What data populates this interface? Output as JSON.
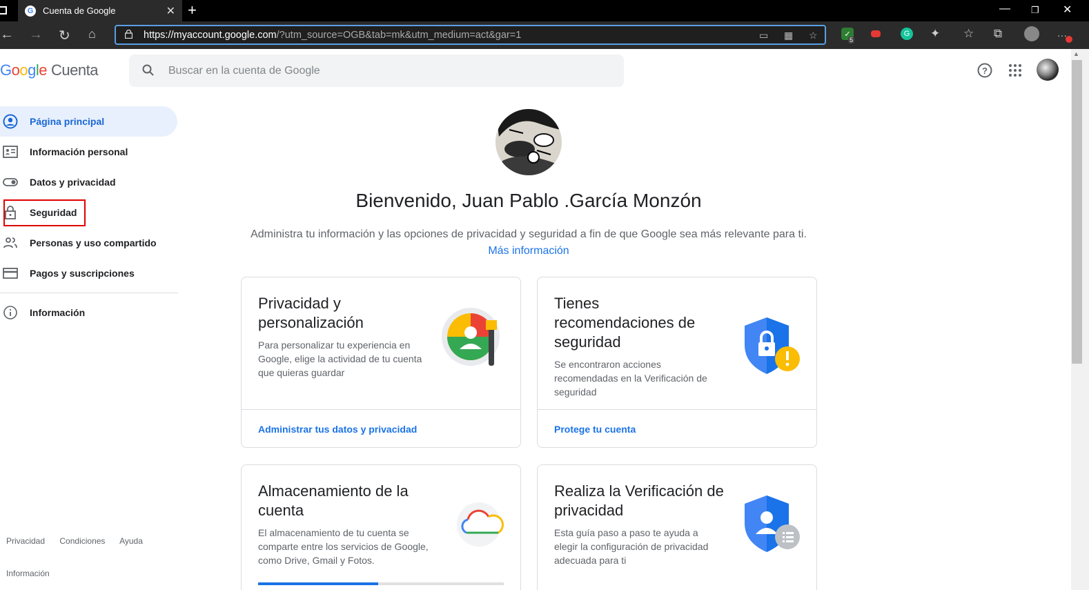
{
  "browser": {
    "tab_title": "Cuenta de Google",
    "url_host": "https://myaccount.google.com",
    "url_rest": "/?utm_source=OGB&tab=mk&utm_medium=act&gar=1",
    "ext_badge": "5"
  },
  "header": {
    "logo_google": "Google",
    "logo_product": "Cuenta",
    "search_placeholder": "Buscar en la cuenta de Google"
  },
  "sidebar": {
    "items": [
      {
        "label": "Página principal",
        "active": true
      },
      {
        "label": "Información personal"
      },
      {
        "label": "Datos y privacidad"
      },
      {
        "label": "Seguridad"
      },
      {
        "label": "Personas y uso compartido"
      },
      {
        "label": "Pagos y suscripciones"
      }
    ],
    "info_label": "Información",
    "footer_links": [
      "Privacidad",
      "Condiciones",
      "Ayuda"
    ],
    "footer_info": "Información"
  },
  "main": {
    "welcome": "Bienvenido, Juan Pablo .García Monzón",
    "subtitle": "Administra tu información y las opciones de privacidad y seguridad a fin de que Google sea más relevante para ti.",
    "more_link": "Más información",
    "cards": [
      {
        "title": "Privacidad y personalización",
        "desc": "Para personalizar tu experiencia en Google, elige la actividad de tu cuenta que quieras guardar",
        "link": "Administrar tus datos y privacidad"
      },
      {
        "title": "Tienes recomendaciones de seguridad",
        "desc": "Se encontraron acciones recomendadas en la Verificación de seguridad",
        "link": "Protege tu cuenta"
      },
      {
        "title": "Almacenamiento de la cuenta",
        "desc": "El almacenamiento de tu cuenta se comparte entre los servicios de Google, como Drive, Gmail y Fotos.",
        "storage_fraction": 0.49
      },
      {
        "title": "Realiza la Verificación de privacidad",
        "desc": "Esta guía paso a paso te ayuda a elegir la configuración de privacidad adecuada para ti"
      }
    ]
  },
  "colors": {
    "accent": "#1a73e8",
    "active_bg": "#e8f0fe",
    "highlight": "#e00000"
  }
}
